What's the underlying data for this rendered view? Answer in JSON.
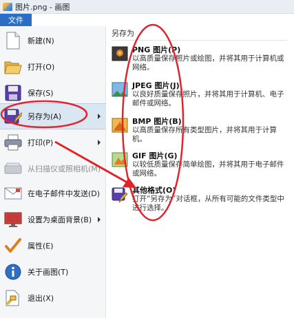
{
  "window": {
    "title": "图片.png - 画图"
  },
  "menubar": {
    "file_tab": "文件"
  },
  "sidebar": {
    "items": [
      {
        "label": "新建(N)",
        "icon": "new-document-icon"
      },
      {
        "label": "打开(O)",
        "icon": "open-folder-icon"
      },
      {
        "label": "保存(S)",
        "icon": "save-disk-icon"
      },
      {
        "label": "另存为(A)",
        "icon": "save-as-icon",
        "active": true,
        "submenu": true
      },
      {
        "label": "打印(P)",
        "icon": "printer-icon",
        "submenu": true
      },
      {
        "label": "从扫描仪或照相机(M)",
        "icon": "scanner-icon",
        "disabled": true
      },
      {
        "label": "在电子邮件中发送(D)",
        "icon": "email-icon"
      },
      {
        "label": "设置为桌面背景(B)",
        "icon": "desktop-background-icon",
        "submenu": true
      },
      {
        "label": "属性(E)",
        "icon": "checkmark-icon"
      },
      {
        "label": "关于画图(T)",
        "icon": "info-icon"
      },
      {
        "label": "退出(X)",
        "icon": "exit-icon"
      }
    ]
  },
  "panel": {
    "title": "另存为",
    "items": [
      {
        "title": "PNG 图片(P)",
        "desc": "以高质量保存照片或绘图，并将其用于计算机或网络。",
        "icon": "png-image-icon"
      },
      {
        "title": "JPEG 图片(J)",
        "desc": "以良好质量保存照片，并将其用于计算机、电子邮件或网络。",
        "icon": "jpeg-image-icon"
      },
      {
        "title": "BMP 图片(B)",
        "desc": "以高质量保存所有类型图片，并将其用于计算机。",
        "icon": "bmp-image-icon"
      },
      {
        "title": "GIF 图片(G)",
        "desc": "以较低质量保存简单绘图，并将其用于电子邮件或网络。",
        "icon": "gif-image-icon"
      },
      {
        "title": "其他格式(O)",
        "desc": "打开“另存为”对话框，从所有可能的文件类型中进行选择。",
        "icon": "other-formats-icon"
      }
    ]
  },
  "annotations": {
    "color": "#e0242a"
  }
}
